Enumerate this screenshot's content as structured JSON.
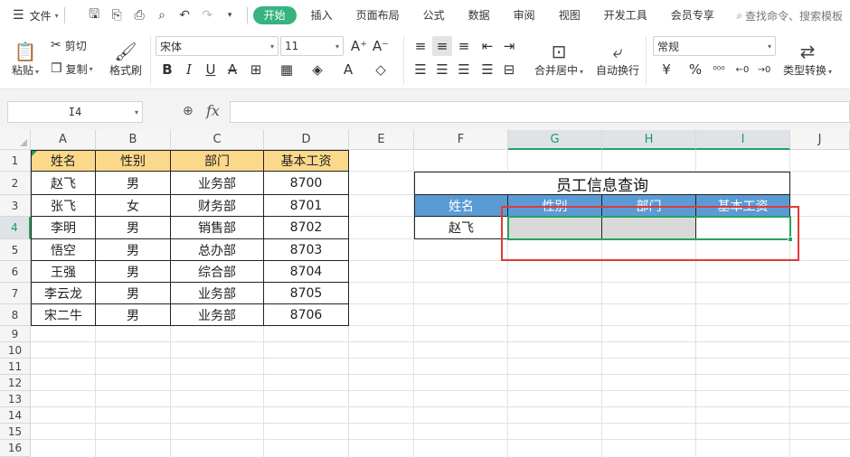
{
  "menubar": {
    "file_label": "文件",
    "tabs": [
      "开始",
      "插入",
      "页面布局",
      "公式",
      "数据",
      "审阅",
      "视图",
      "开发工具",
      "会员专享"
    ],
    "active_tab": "开始",
    "search_placeholder": "查找命令、搜索模板"
  },
  "ribbon": {
    "paste": "粘贴",
    "cut": "剪切",
    "copy": "复制",
    "format_painter": "格式刷",
    "font_name": "宋体",
    "font_size": "11",
    "merge_center": "合并居中",
    "wrap_text": "自动换行",
    "number_format": "常规",
    "type_convert": "类型转换"
  },
  "formula_bar": {
    "name_box": "I4",
    "fx": "fx",
    "formula": ""
  },
  "columns": [
    "A",
    "B",
    "C",
    "D",
    "E",
    "F",
    "G",
    "H",
    "I",
    "J"
  ],
  "rows": [
    "1",
    "2",
    "3",
    "4",
    "5",
    "6",
    "7",
    "8",
    "9",
    "10",
    "11",
    "12",
    "13",
    "14",
    "15",
    "16"
  ],
  "table1": {
    "headers": [
      "姓名",
      "性别",
      "部门",
      "基本工资"
    ],
    "rows": [
      [
        "赵飞",
        "男",
        "业务部",
        "8700"
      ],
      [
        "张飞",
        "女",
        "财务部",
        "8701"
      ],
      [
        "李明",
        "男",
        "销售部",
        "8702"
      ],
      [
        "悟空",
        "男",
        "总办部",
        "8703"
      ],
      [
        "王强",
        "男",
        "综合部",
        "8704"
      ],
      [
        "李云龙",
        "男",
        "业务部",
        "8705"
      ],
      [
        "宋二牛",
        "男",
        "业务部",
        "8706"
      ]
    ]
  },
  "lookup": {
    "title": "员工信息查询",
    "headers": [
      "姓名",
      "性别",
      "部门",
      "基本工资"
    ],
    "name_value": "赵飞"
  },
  "colors": {
    "accent_green": "#22a55d",
    "header_yellow": "#fcd98a",
    "header_blue": "#5b9bd5",
    "highlight_red": "#e03a3a"
  }
}
